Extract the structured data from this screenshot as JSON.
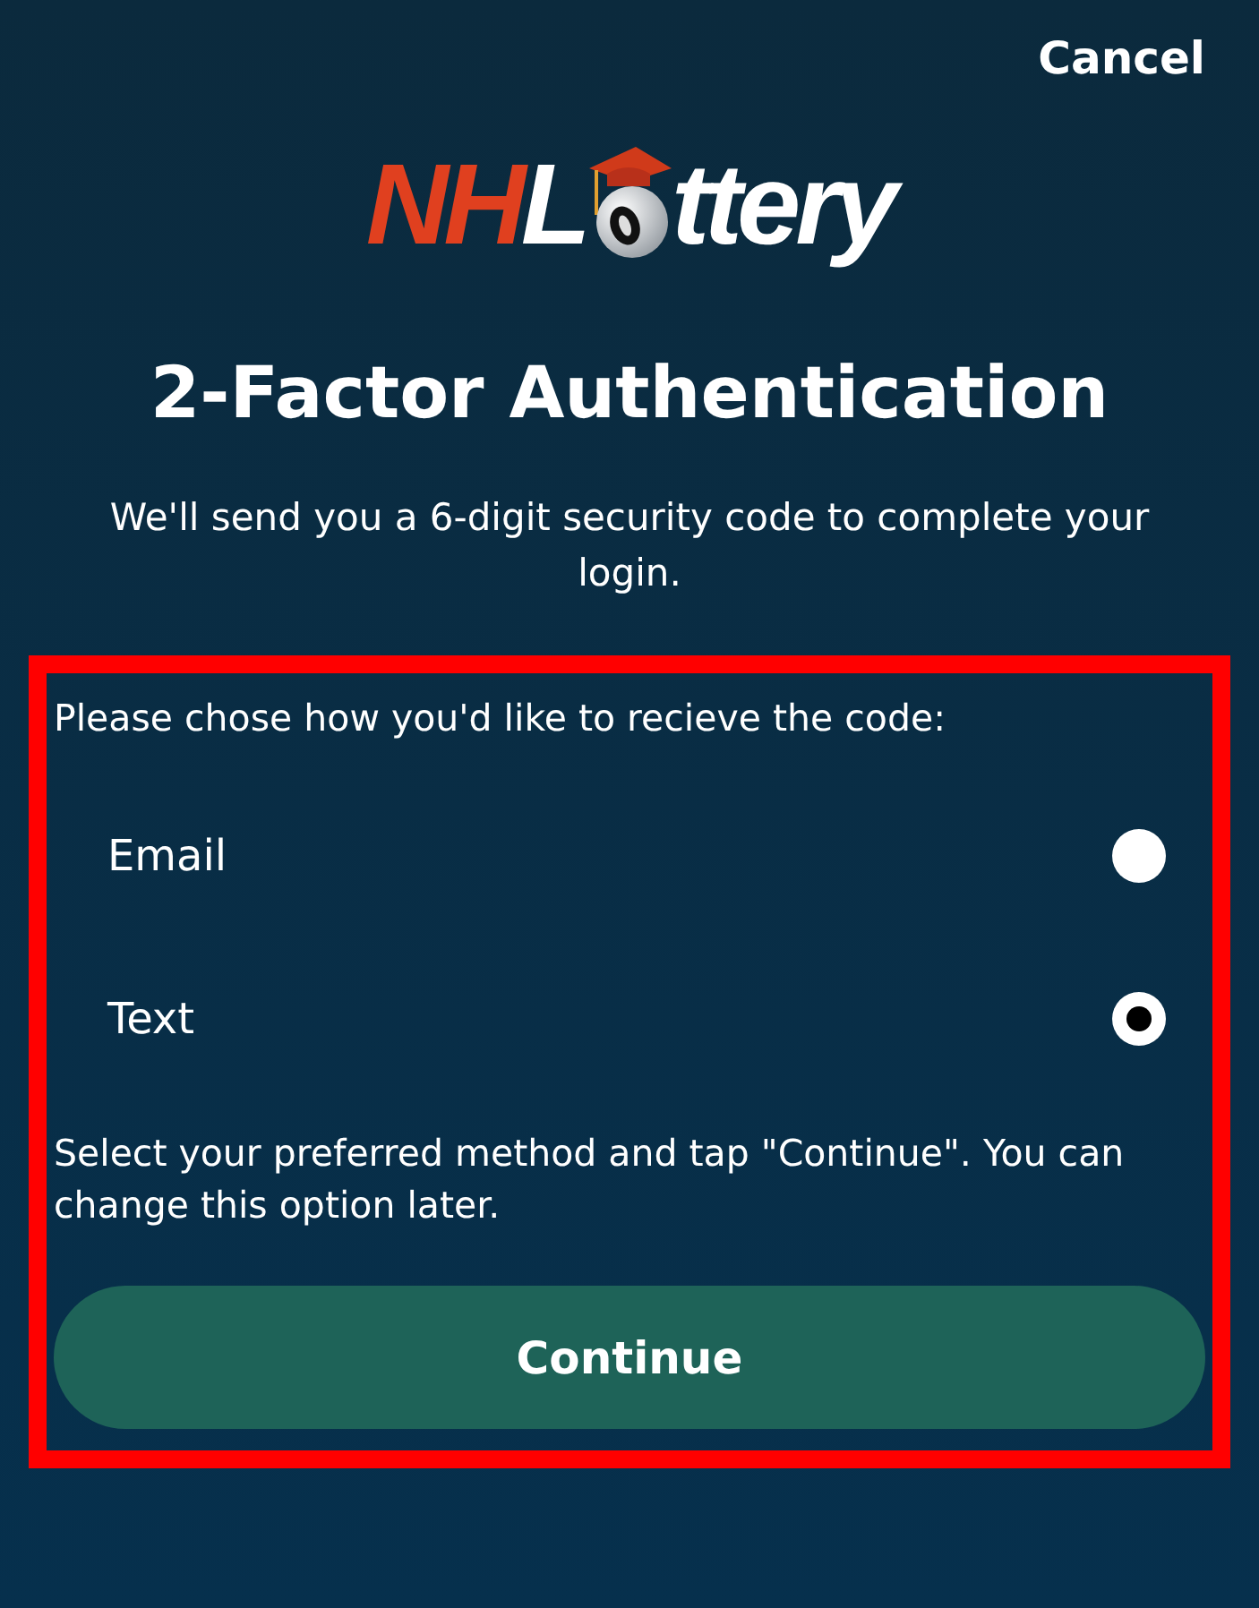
{
  "header": {
    "cancel": "Cancel"
  },
  "logo": {
    "prefix": "NH",
    "word_start": "L",
    "word_end": "ttery"
  },
  "title": "2-Factor Authentication",
  "intro": "We'll send you a 6-digit security code to complete your login.",
  "prompt": "Please chose how you'd like to recieve the code:",
  "options": [
    {
      "label": "Email",
      "selected": false
    },
    {
      "label": "Text",
      "selected": true
    }
  ],
  "note": "Select your preferred method and tap \"Continue\". You can change this option later.",
  "continue_button": "Continue"
}
